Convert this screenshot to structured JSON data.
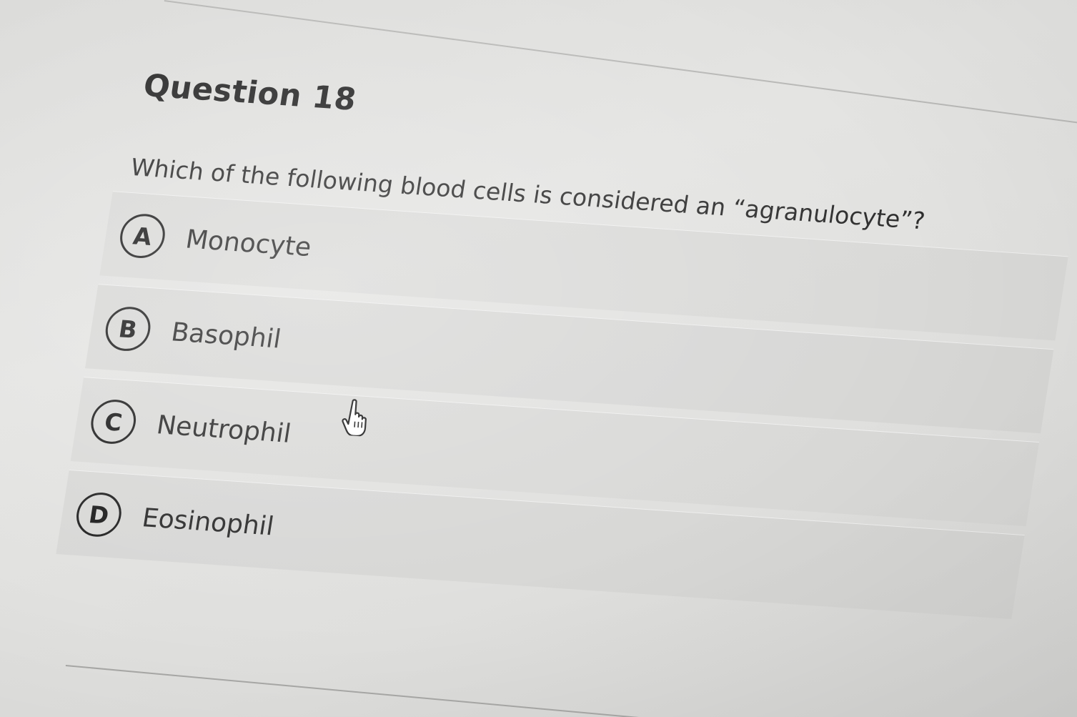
{
  "question": {
    "title": "Question 18",
    "prompt": "Which of the following blood cells is considered an “agranulocyte”?",
    "choices": [
      {
        "letter": "A",
        "label": "Monocyte"
      },
      {
        "letter": "B",
        "label": "Basophil"
      },
      {
        "letter": "C",
        "label": "Neutrophil"
      },
      {
        "letter": "D",
        "label": "Eosinophil"
      }
    ]
  },
  "cursor": {
    "icon": "hand-pointer-icon"
  }
}
